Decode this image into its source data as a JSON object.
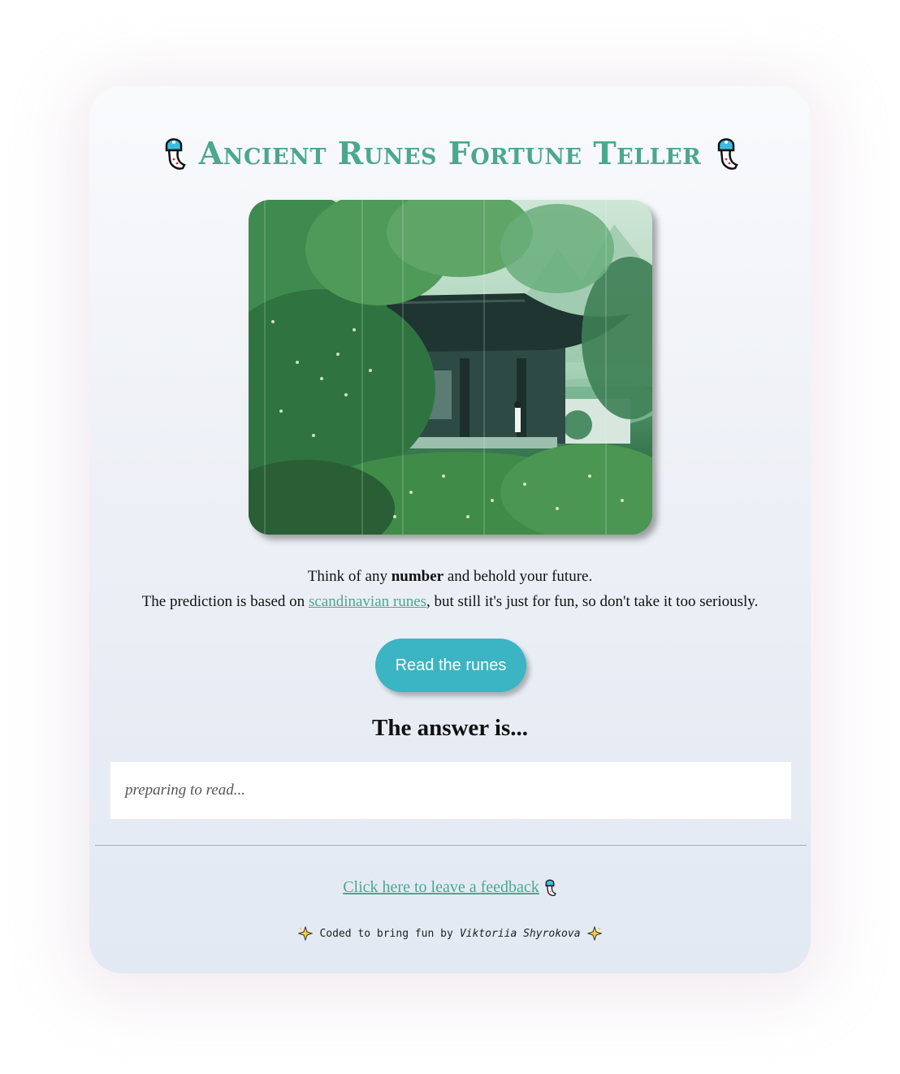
{
  "header": {
    "title": "Ancient Runes Fortune Teller",
    "title_icon": "wind-chime-icon"
  },
  "hero": {
    "image": "chinese-pavilion-in-forest-rain"
  },
  "intro": {
    "line1_before": "Think of any ",
    "line1_bold": "number",
    "line1_after": " and behold your future.",
    "line2_before": "The prediction is based on ",
    "line2_link": "scandinavian runes",
    "line2_after": ", but still it's just for fun, so don't take it too seriously."
  },
  "actions": {
    "read_button_label": "Read the runes"
  },
  "answer": {
    "heading": "The answer is...",
    "placeholder": "preparing to read..."
  },
  "feedback": {
    "link_text": "Click here to leave a feedback"
  },
  "footer": {
    "text": "Coded to bring fun by",
    "author": "Viktoriia Shyrokova",
    "sparkle_icon": "sparkles-icon"
  },
  "colors": {
    "accent": "#4aa88d",
    "button": "#3bb5c3"
  }
}
